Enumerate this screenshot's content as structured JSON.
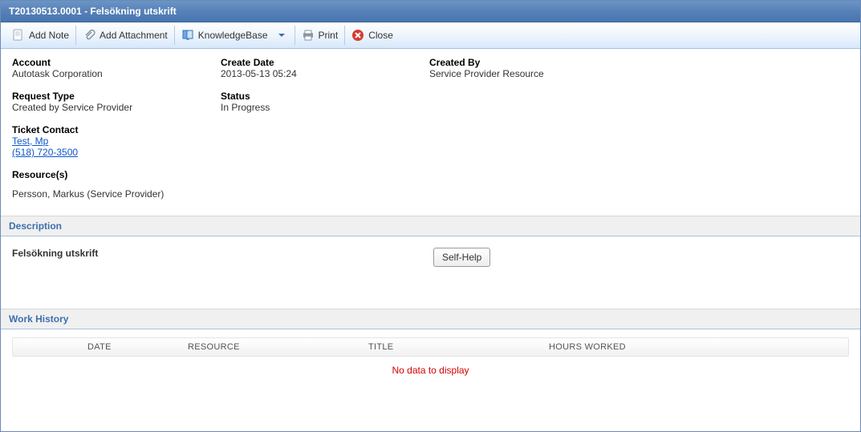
{
  "title": "T20130513.0001 - Felsökning utskrift",
  "toolbar": {
    "add_note": "Add Note",
    "add_attachment": "Add Attachment",
    "knowledgebase": "KnowledgeBase",
    "print": "Print",
    "close": "Close"
  },
  "details": {
    "account_label": "Account",
    "account_value": "Autotask Corporation",
    "request_type_label": "Request Type",
    "request_type_value": "Created by Service Provider",
    "ticket_contact_label": "Ticket Contact",
    "ticket_contact_name": "Test, Mp",
    "ticket_contact_phone": "(518) 720-3500",
    "resources_label": "Resource(s)",
    "resources_value": "Persson, Markus (Service Provider)",
    "create_date_label": "Create Date",
    "create_date_value": "2013-05-13 05:24",
    "status_label": "Status",
    "status_value": "In Progress",
    "created_by_label": "Created By",
    "created_by_value": "Service Provider Resource"
  },
  "sections": {
    "description": "Description",
    "work_history": "Work History"
  },
  "description": {
    "text": "Felsökning utskrift",
    "self_help": "Self-Help"
  },
  "history": {
    "columns": {
      "date": "DATE",
      "resource": "RESOURCE",
      "title": "TITLE",
      "hours": "HOURS WORKED"
    },
    "no_data": "No data to display"
  }
}
